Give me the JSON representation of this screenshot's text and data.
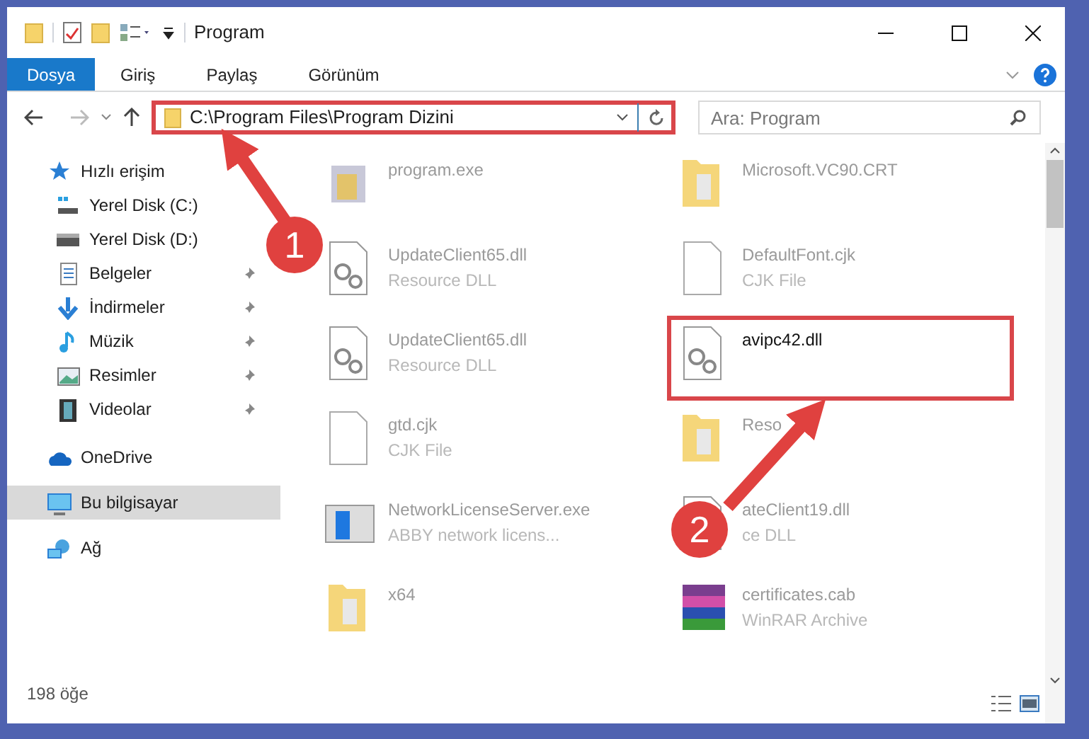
{
  "window": {
    "title": "Program"
  },
  "ribbon_tabs": [
    {
      "label": "Dosya",
      "selected": true
    },
    {
      "label": "Giriş",
      "selected": false
    },
    {
      "label": "Paylaş",
      "selected": false
    },
    {
      "label": "Görünüm",
      "selected": false
    }
  ],
  "address_bar": {
    "path": "C:\\Program Files\\Program Dizini",
    "highlighted": true
  },
  "search": {
    "placeholder": "Ara: Program"
  },
  "sidebar": {
    "items": [
      {
        "label": "Hızlı erişim",
        "selected": false,
        "children": [
          {
            "label": "Yerel Disk (C:)",
            "selected": false
          },
          {
            "label": "Yerel Disk (D:)",
            "selected": false
          },
          {
            "label": "Belgeler",
            "pinned": true,
            "selected": false
          },
          {
            "label": "İndirmeler",
            "pinned": true,
            "selected": false
          },
          {
            "label": "Müzik",
            "pinned": true,
            "selected": false
          },
          {
            "label": "Resimler",
            "pinned": true,
            "selected": false
          },
          {
            "label": "Videolar",
            "pinned": true,
            "selected": false
          }
        ]
      },
      {
        "label": "OneDrive",
        "selected": false
      },
      {
        "label": "Bu bilgisayar",
        "selected": true
      },
      {
        "label": "Ağ",
        "selected": false
      }
    ]
  },
  "files": [
    {
      "name": "program.exe",
      "kind": "exe",
      "highlighted": false,
      "dimmed": true
    },
    {
      "name": "Microsoft.VC90.CRT",
      "kind": "folder",
      "highlighted": false,
      "dimmed": true
    },
    {
      "name": "UpdateClient65.dll",
      "type": "Resource DLL",
      "kind": "dll",
      "highlighted": false,
      "dimmed": true
    },
    {
      "name": "DefaultFont.cjk",
      "type": "CJK File",
      "kind": "file",
      "highlighted": false,
      "dimmed": true
    },
    {
      "name": "UpdateClient65.dll",
      "type": "Resource DLL",
      "kind": "dll",
      "highlighted": false,
      "dimmed": true
    },
    {
      "name": "avipc42.dll",
      "kind": "dll",
      "highlighted": true,
      "dimmed": false
    },
    {
      "name": "gtd.cjk",
      "type": "CJK File",
      "kind": "file",
      "highlighted": false,
      "dimmed": true
    },
    {
      "name": "Reso",
      "kind": "folder",
      "highlighted": false,
      "dimmed": true
    },
    {
      "name": "NetworkLicenseServer.exe",
      "type": "ABBY network licens...",
      "kind": "app",
      "highlighted": false,
      "dimmed": true
    },
    {
      "name": "ateClient19.dll",
      "type": "ce DLL",
      "kind": "dll",
      "highlighted": false,
      "dimmed": true
    },
    {
      "name": "x64",
      "kind": "folder",
      "highlighted": false,
      "dimmed": true
    },
    {
      "name": "certificates.cab",
      "type": "WinRAR Archive",
      "kind": "archive",
      "highlighted": false,
      "dimmed": true
    }
  ],
  "status_bar": {
    "item_count": "198 öğe"
  },
  "annotations": [
    {
      "number": "1"
    },
    {
      "number": "2"
    }
  ]
}
